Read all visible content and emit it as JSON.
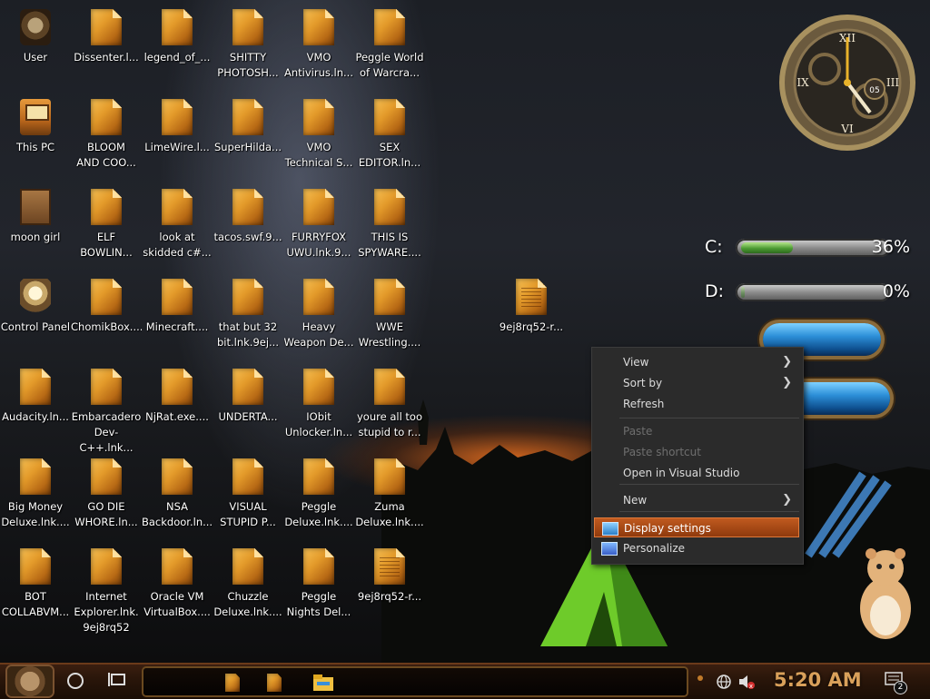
{
  "desktop": {
    "icons": [
      {
        "label": "User",
        "glyph": "user-icon"
      },
      {
        "label": "Dissenter.l...",
        "glyph": "file-icon"
      },
      {
        "label": "legend_of_...",
        "glyph": "file-icon"
      },
      {
        "label": "SHITTY\nPHOTOSH...",
        "glyph": "file-icon"
      },
      {
        "label": "VMO\nAntivirus.ln...",
        "glyph": "file-icon"
      },
      {
        "label": "Peggle World\nof Warcra...",
        "glyph": "file-icon"
      },
      {
        "label": "This PC",
        "glyph": "computer-icon"
      },
      {
        "label": "BLOOM\nAND COO...",
        "glyph": "file-icon"
      },
      {
        "label": "LimeWire.l...",
        "glyph": "file-icon"
      },
      {
        "label": "SuperHilda...",
        "glyph": "file-icon"
      },
      {
        "label": "VMO\nTechnical S...",
        "glyph": "file-icon"
      },
      {
        "label": "SEX\nEDITOR.ln...",
        "glyph": "file-icon"
      },
      {
        "label": "moon girl",
        "glyph": "box-icon"
      },
      {
        "label": "ELF\nBOWLIN...",
        "glyph": "file-icon"
      },
      {
        "label": "look at\nskidded c#...",
        "glyph": "file-icon"
      },
      {
        "label": "tacos.swf.9...",
        "glyph": "file-icon"
      },
      {
        "label": "FURRYFOX\nUWU.lnk.9...",
        "glyph": "file-icon"
      },
      {
        "label": "THIS IS\nSPYWARE....",
        "glyph": "file-icon"
      },
      {
        "label": "Control Panel",
        "glyph": "lightbulb-icon"
      },
      {
        "label": "ChomikBox....",
        "glyph": "file-icon"
      },
      {
        "label": "Minecraft....",
        "glyph": "file-icon"
      },
      {
        "label": "that but 32\nbit.lnk.9ej...",
        "glyph": "file-icon"
      },
      {
        "label": "Heavy\nWeapon De...",
        "glyph": "file-icon"
      },
      {
        "label": "WWE\nWrestling....",
        "glyph": "file-icon"
      },
      {
        "label": "Audacity.ln...",
        "glyph": "file-icon"
      },
      {
        "label": "Embarcadero\nDev-C++.lnk...",
        "glyph": "file-icon"
      },
      {
        "label": "NjRat.exe....",
        "glyph": "file-icon"
      },
      {
        "label": "UNDERTA...",
        "glyph": "file-icon"
      },
      {
        "label": "IObit\nUnlocker.ln...",
        "glyph": "file-icon"
      },
      {
        "label": "youre all too\nstupid to r...",
        "glyph": "file-icon"
      },
      {
        "label": "Big Money\nDeluxe.lnk....",
        "glyph": "file-icon"
      },
      {
        "label": "GO DIE\nWHORE.ln...",
        "glyph": "file-icon"
      },
      {
        "label": "NSA\nBackdoor.ln...",
        "glyph": "file-icon"
      },
      {
        "label": "VISUAL\nSTUPID P...",
        "glyph": "file-icon"
      },
      {
        "label": "Peggle\nDeluxe.lnk....",
        "glyph": "file-icon"
      },
      {
        "label": "Zuma\nDeluxe.lnk....",
        "glyph": "file-icon"
      },
      {
        "label": "BOT\nCOLLABVM...",
        "glyph": "file-icon"
      },
      {
        "label": "Internet\nExplorer.lnk.\n9ej8rq52",
        "glyph": "file-icon"
      },
      {
        "label": "Oracle VM\nVirtualBox....",
        "glyph": "file-icon"
      },
      {
        "label": "Chuzzle\nDeluxe.lnk....",
        "glyph": "file-icon"
      },
      {
        "label": "Peggle\nNights Del...",
        "glyph": "file-icon"
      },
      {
        "label": "9ej8rq52-r...",
        "glyph": "text-file-icon"
      },
      {
        "label": "9ej8rq52-r...",
        "glyph": "text-file-icon"
      }
    ]
  },
  "widgets": {
    "clock_hour_mark": "05",
    "drives": [
      {
        "label": "C:",
        "value": "36%",
        "fraction": 0.36
      },
      {
        "label": "D:",
        "value": "0%",
        "fraction": 0.0
      }
    ]
  },
  "context_menu": {
    "items": [
      {
        "label": "View",
        "state": "normal",
        "submenu": true
      },
      {
        "label": "Sort by",
        "state": "normal",
        "submenu": true
      },
      {
        "label": "Refresh",
        "state": "normal",
        "submenu": false
      },
      {
        "label": "Paste",
        "state": "disabled",
        "submenu": false
      },
      {
        "label": "Paste shortcut",
        "state": "disabled",
        "submenu": false
      },
      {
        "label": "Open in Visual Studio",
        "state": "normal",
        "submenu": false
      },
      {
        "label": "New",
        "state": "normal",
        "submenu": true
      },
      {
        "label": "Display settings",
        "state": "highlighted",
        "submenu": false,
        "icon": "monitor-icon"
      },
      {
        "label": "Personalize",
        "state": "normal",
        "submenu": false,
        "icon": "personalize-icon"
      }
    ],
    "submenu_glyph": "❯"
  },
  "taskbar": {
    "time": "5:20 AM",
    "notification_count": "2",
    "pinned": [
      "file-icon",
      "file-icon",
      "file-explorer-icon"
    ]
  },
  "colors": {
    "accent_orange": "#c05a1f",
    "clock_text": "#d9a05a",
    "meter_green": "#4c9b33"
  }
}
